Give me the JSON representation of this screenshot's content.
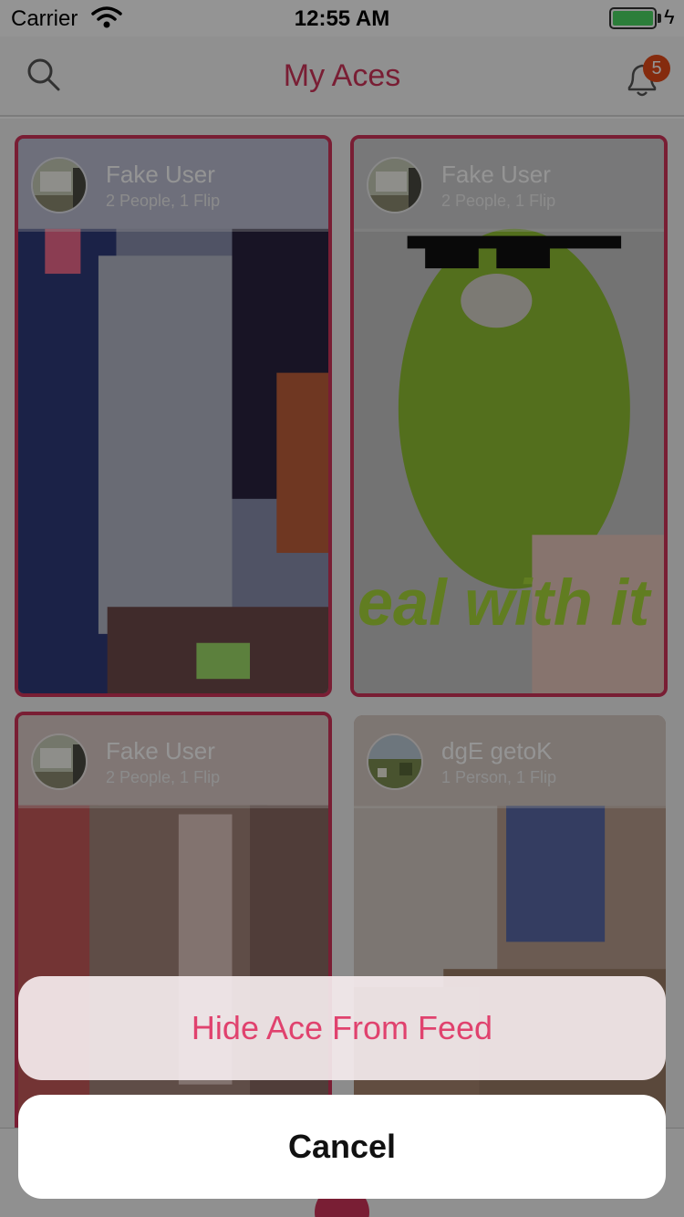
{
  "status_bar": {
    "carrier": "Carrier",
    "time": "12:55 AM"
  },
  "nav": {
    "title": "My Aces",
    "notification_count": "5"
  },
  "cards": [
    {
      "name": "Fake User",
      "meta": "2 People, 1 Flip",
      "selected": true
    },
    {
      "name": "Fake User",
      "meta": "2 People, 1 Flip",
      "selected": true,
      "overlay_text": "eal with it"
    },
    {
      "name": "Fake User",
      "meta": "2 People, 1 Flip",
      "selected": true
    },
    {
      "name": "dgE getoK",
      "meta": "1 Person, 1 Flip",
      "selected": false
    }
  ],
  "action_sheet": {
    "option_label": "Hide Ace From Feed",
    "cancel_label": "Cancel"
  },
  "colors": {
    "accent": "#d1345b",
    "badge": "#e64a19",
    "battery": "#4cd964",
    "option_text": "#e0426e"
  }
}
